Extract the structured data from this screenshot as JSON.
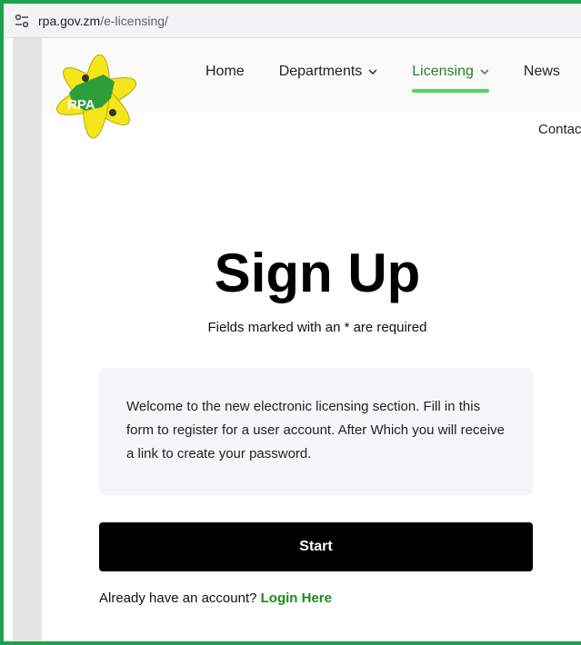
{
  "browser": {
    "url_host": "rpa.gov.zm",
    "url_path": "/e-licensing/",
    "site_icon": "tune-icon"
  },
  "header": {
    "logo_text": "RPA",
    "nav": [
      {
        "label": "Home",
        "has_caret": false,
        "active": false
      },
      {
        "label": "Departments",
        "has_caret": true,
        "active": false
      },
      {
        "label": "Licensing",
        "has_caret": true,
        "active": true
      },
      {
        "label": "News",
        "has_caret": false,
        "active": false
      }
    ],
    "contact_label": "Contact"
  },
  "main": {
    "title": "Sign Up",
    "subtitle": "Fields marked with an * are required",
    "intro": "Welcome to the new electronic licensing section. Fill in this form to register for a user account. After Which you will receive a link to create your password.",
    "start_label": "Start",
    "login_prompt": "Already have an account?",
    "login_link": "Login Here"
  },
  "colors": {
    "frame": "#1aa34a",
    "active_nav": "#2b7d2b",
    "nav_underline": "#54d45a",
    "link": "#1f8a1f",
    "button": "#000000"
  }
}
